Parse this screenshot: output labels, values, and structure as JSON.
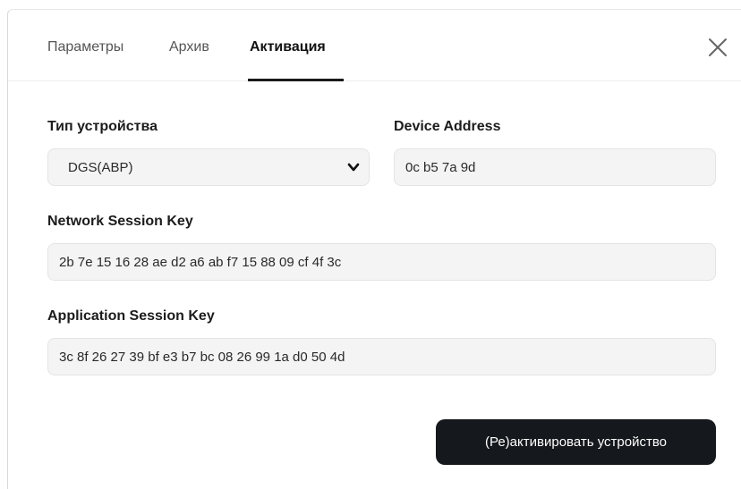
{
  "tabs": [
    {
      "label": "Параметры",
      "active": false
    },
    {
      "label": "Архив",
      "active": false
    },
    {
      "label": "Активация",
      "active": true
    }
  ],
  "device_type": {
    "label": "Тип устройства",
    "value": "DGS(ABP)"
  },
  "device_address": {
    "label": "Device Address",
    "value": "0c b5 7a 9d"
  },
  "network_session_key": {
    "label": "Network Session Key",
    "value": "2b 7e 15 16 28 ae d2 a6 ab f7 15 88 09 cf 4f 3c"
  },
  "application_session_key": {
    "label": "Application Session Key",
    "value": "3c 8f 26 27 39 bf e3 b7 bc 08 26 99 1a d0 50 4d"
  },
  "activate_button": {
    "label": "(Ре)активировать устройство"
  },
  "icons": {
    "close": "close-icon",
    "dropdown": "chevron-down-icon"
  },
  "colors": {
    "primary_button": "#15181c",
    "field_bg": "#f4f4f4",
    "active_tab": "#111111"
  }
}
